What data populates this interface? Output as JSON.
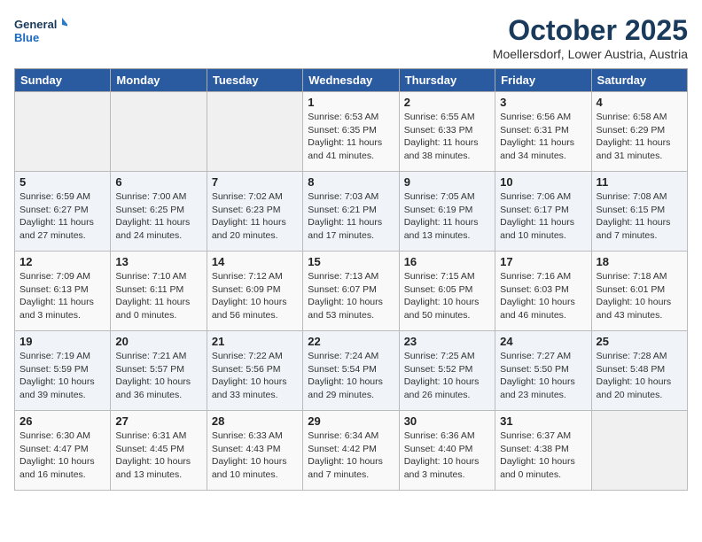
{
  "header": {
    "logo_line1": "General",
    "logo_line2": "Blue",
    "month": "October 2025",
    "location": "Moellersdorf, Lower Austria, Austria"
  },
  "days_of_week": [
    "Sunday",
    "Monday",
    "Tuesday",
    "Wednesday",
    "Thursday",
    "Friday",
    "Saturday"
  ],
  "weeks": [
    [
      {
        "day": "",
        "info": ""
      },
      {
        "day": "",
        "info": ""
      },
      {
        "day": "",
        "info": ""
      },
      {
        "day": "1",
        "info": "Sunrise: 6:53 AM\nSunset: 6:35 PM\nDaylight: 11 hours\nand 41 minutes."
      },
      {
        "day": "2",
        "info": "Sunrise: 6:55 AM\nSunset: 6:33 PM\nDaylight: 11 hours\nand 38 minutes."
      },
      {
        "day": "3",
        "info": "Sunrise: 6:56 AM\nSunset: 6:31 PM\nDaylight: 11 hours\nand 34 minutes."
      },
      {
        "day": "4",
        "info": "Sunrise: 6:58 AM\nSunset: 6:29 PM\nDaylight: 11 hours\nand 31 minutes."
      }
    ],
    [
      {
        "day": "5",
        "info": "Sunrise: 6:59 AM\nSunset: 6:27 PM\nDaylight: 11 hours\nand 27 minutes."
      },
      {
        "day": "6",
        "info": "Sunrise: 7:00 AM\nSunset: 6:25 PM\nDaylight: 11 hours\nand 24 minutes."
      },
      {
        "day": "7",
        "info": "Sunrise: 7:02 AM\nSunset: 6:23 PM\nDaylight: 11 hours\nand 20 minutes."
      },
      {
        "day": "8",
        "info": "Sunrise: 7:03 AM\nSunset: 6:21 PM\nDaylight: 11 hours\nand 17 minutes."
      },
      {
        "day": "9",
        "info": "Sunrise: 7:05 AM\nSunset: 6:19 PM\nDaylight: 11 hours\nand 13 minutes."
      },
      {
        "day": "10",
        "info": "Sunrise: 7:06 AM\nSunset: 6:17 PM\nDaylight: 11 hours\nand 10 minutes."
      },
      {
        "day": "11",
        "info": "Sunrise: 7:08 AM\nSunset: 6:15 PM\nDaylight: 11 hours\nand 7 minutes."
      }
    ],
    [
      {
        "day": "12",
        "info": "Sunrise: 7:09 AM\nSunset: 6:13 PM\nDaylight: 11 hours\nand 3 minutes."
      },
      {
        "day": "13",
        "info": "Sunrise: 7:10 AM\nSunset: 6:11 PM\nDaylight: 11 hours\nand 0 minutes."
      },
      {
        "day": "14",
        "info": "Sunrise: 7:12 AM\nSunset: 6:09 PM\nDaylight: 10 hours\nand 56 minutes."
      },
      {
        "day": "15",
        "info": "Sunrise: 7:13 AM\nSunset: 6:07 PM\nDaylight: 10 hours\nand 53 minutes."
      },
      {
        "day": "16",
        "info": "Sunrise: 7:15 AM\nSunset: 6:05 PM\nDaylight: 10 hours\nand 50 minutes."
      },
      {
        "day": "17",
        "info": "Sunrise: 7:16 AM\nSunset: 6:03 PM\nDaylight: 10 hours\nand 46 minutes."
      },
      {
        "day": "18",
        "info": "Sunrise: 7:18 AM\nSunset: 6:01 PM\nDaylight: 10 hours\nand 43 minutes."
      }
    ],
    [
      {
        "day": "19",
        "info": "Sunrise: 7:19 AM\nSunset: 5:59 PM\nDaylight: 10 hours\nand 39 minutes."
      },
      {
        "day": "20",
        "info": "Sunrise: 7:21 AM\nSunset: 5:57 PM\nDaylight: 10 hours\nand 36 minutes."
      },
      {
        "day": "21",
        "info": "Sunrise: 7:22 AM\nSunset: 5:56 PM\nDaylight: 10 hours\nand 33 minutes."
      },
      {
        "day": "22",
        "info": "Sunrise: 7:24 AM\nSunset: 5:54 PM\nDaylight: 10 hours\nand 29 minutes."
      },
      {
        "day": "23",
        "info": "Sunrise: 7:25 AM\nSunset: 5:52 PM\nDaylight: 10 hours\nand 26 minutes."
      },
      {
        "day": "24",
        "info": "Sunrise: 7:27 AM\nSunset: 5:50 PM\nDaylight: 10 hours\nand 23 minutes."
      },
      {
        "day": "25",
        "info": "Sunrise: 7:28 AM\nSunset: 5:48 PM\nDaylight: 10 hours\nand 20 minutes."
      }
    ],
    [
      {
        "day": "26",
        "info": "Sunrise: 6:30 AM\nSunset: 4:47 PM\nDaylight: 10 hours\nand 16 minutes."
      },
      {
        "day": "27",
        "info": "Sunrise: 6:31 AM\nSunset: 4:45 PM\nDaylight: 10 hours\nand 13 minutes."
      },
      {
        "day": "28",
        "info": "Sunrise: 6:33 AM\nSunset: 4:43 PM\nDaylight: 10 hours\nand 10 minutes."
      },
      {
        "day": "29",
        "info": "Sunrise: 6:34 AM\nSunset: 4:42 PM\nDaylight: 10 hours\nand 7 minutes."
      },
      {
        "day": "30",
        "info": "Sunrise: 6:36 AM\nSunset: 4:40 PM\nDaylight: 10 hours\nand 3 minutes."
      },
      {
        "day": "31",
        "info": "Sunrise: 6:37 AM\nSunset: 4:38 PM\nDaylight: 10 hours\nand 0 minutes."
      },
      {
        "day": "",
        "info": ""
      }
    ]
  ]
}
